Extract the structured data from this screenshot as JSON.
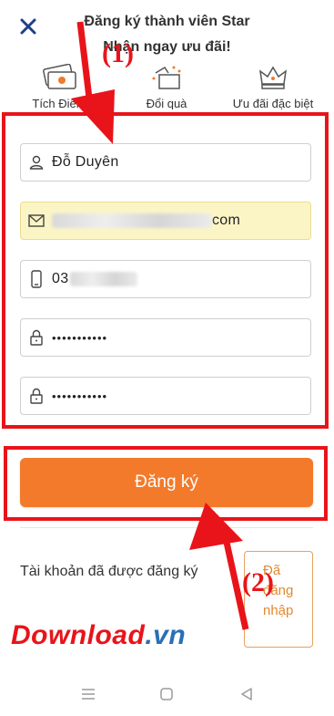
{
  "header": {
    "title_line1": "Đăng ký thành viên Star",
    "title_line2": "Nhận ngay ưu đãi!",
    "close_icon": "close-icon"
  },
  "benefits": [
    {
      "label": "Tích Điểm",
      "icon": "ticket-icon"
    },
    {
      "label": "Đổi quà",
      "icon": "gift-icon"
    },
    {
      "label": "Ưu đãi đặc biệt",
      "icon": "crown-icon"
    }
  ],
  "form": {
    "name": {
      "value": "Đỗ Duyên",
      "icon": "user-icon"
    },
    "email": {
      "suffix": "com",
      "icon": "mail-icon"
    },
    "phone": {
      "prefix": "03",
      "icon": "phone-icon"
    },
    "password": {
      "value": "•••••••••••",
      "icon": "lock-icon"
    },
    "confirm_password": {
      "value": "•••••••••••",
      "icon": "lock-icon"
    }
  },
  "submit_label": "Đăng ký",
  "login_prompt": "Tài khoản đã được đăng ký",
  "login_button": "Đã đăng nhập",
  "annotations": {
    "step1": "(1)",
    "step2": "(2)"
  },
  "watermark": {
    "part1": "Download",
    "part2": ".vn"
  },
  "colors": {
    "accent": "#f37a2a",
    "annotation_red": "#e8141a",
    "highlight_field": "#fbf5c6"
  }
}
